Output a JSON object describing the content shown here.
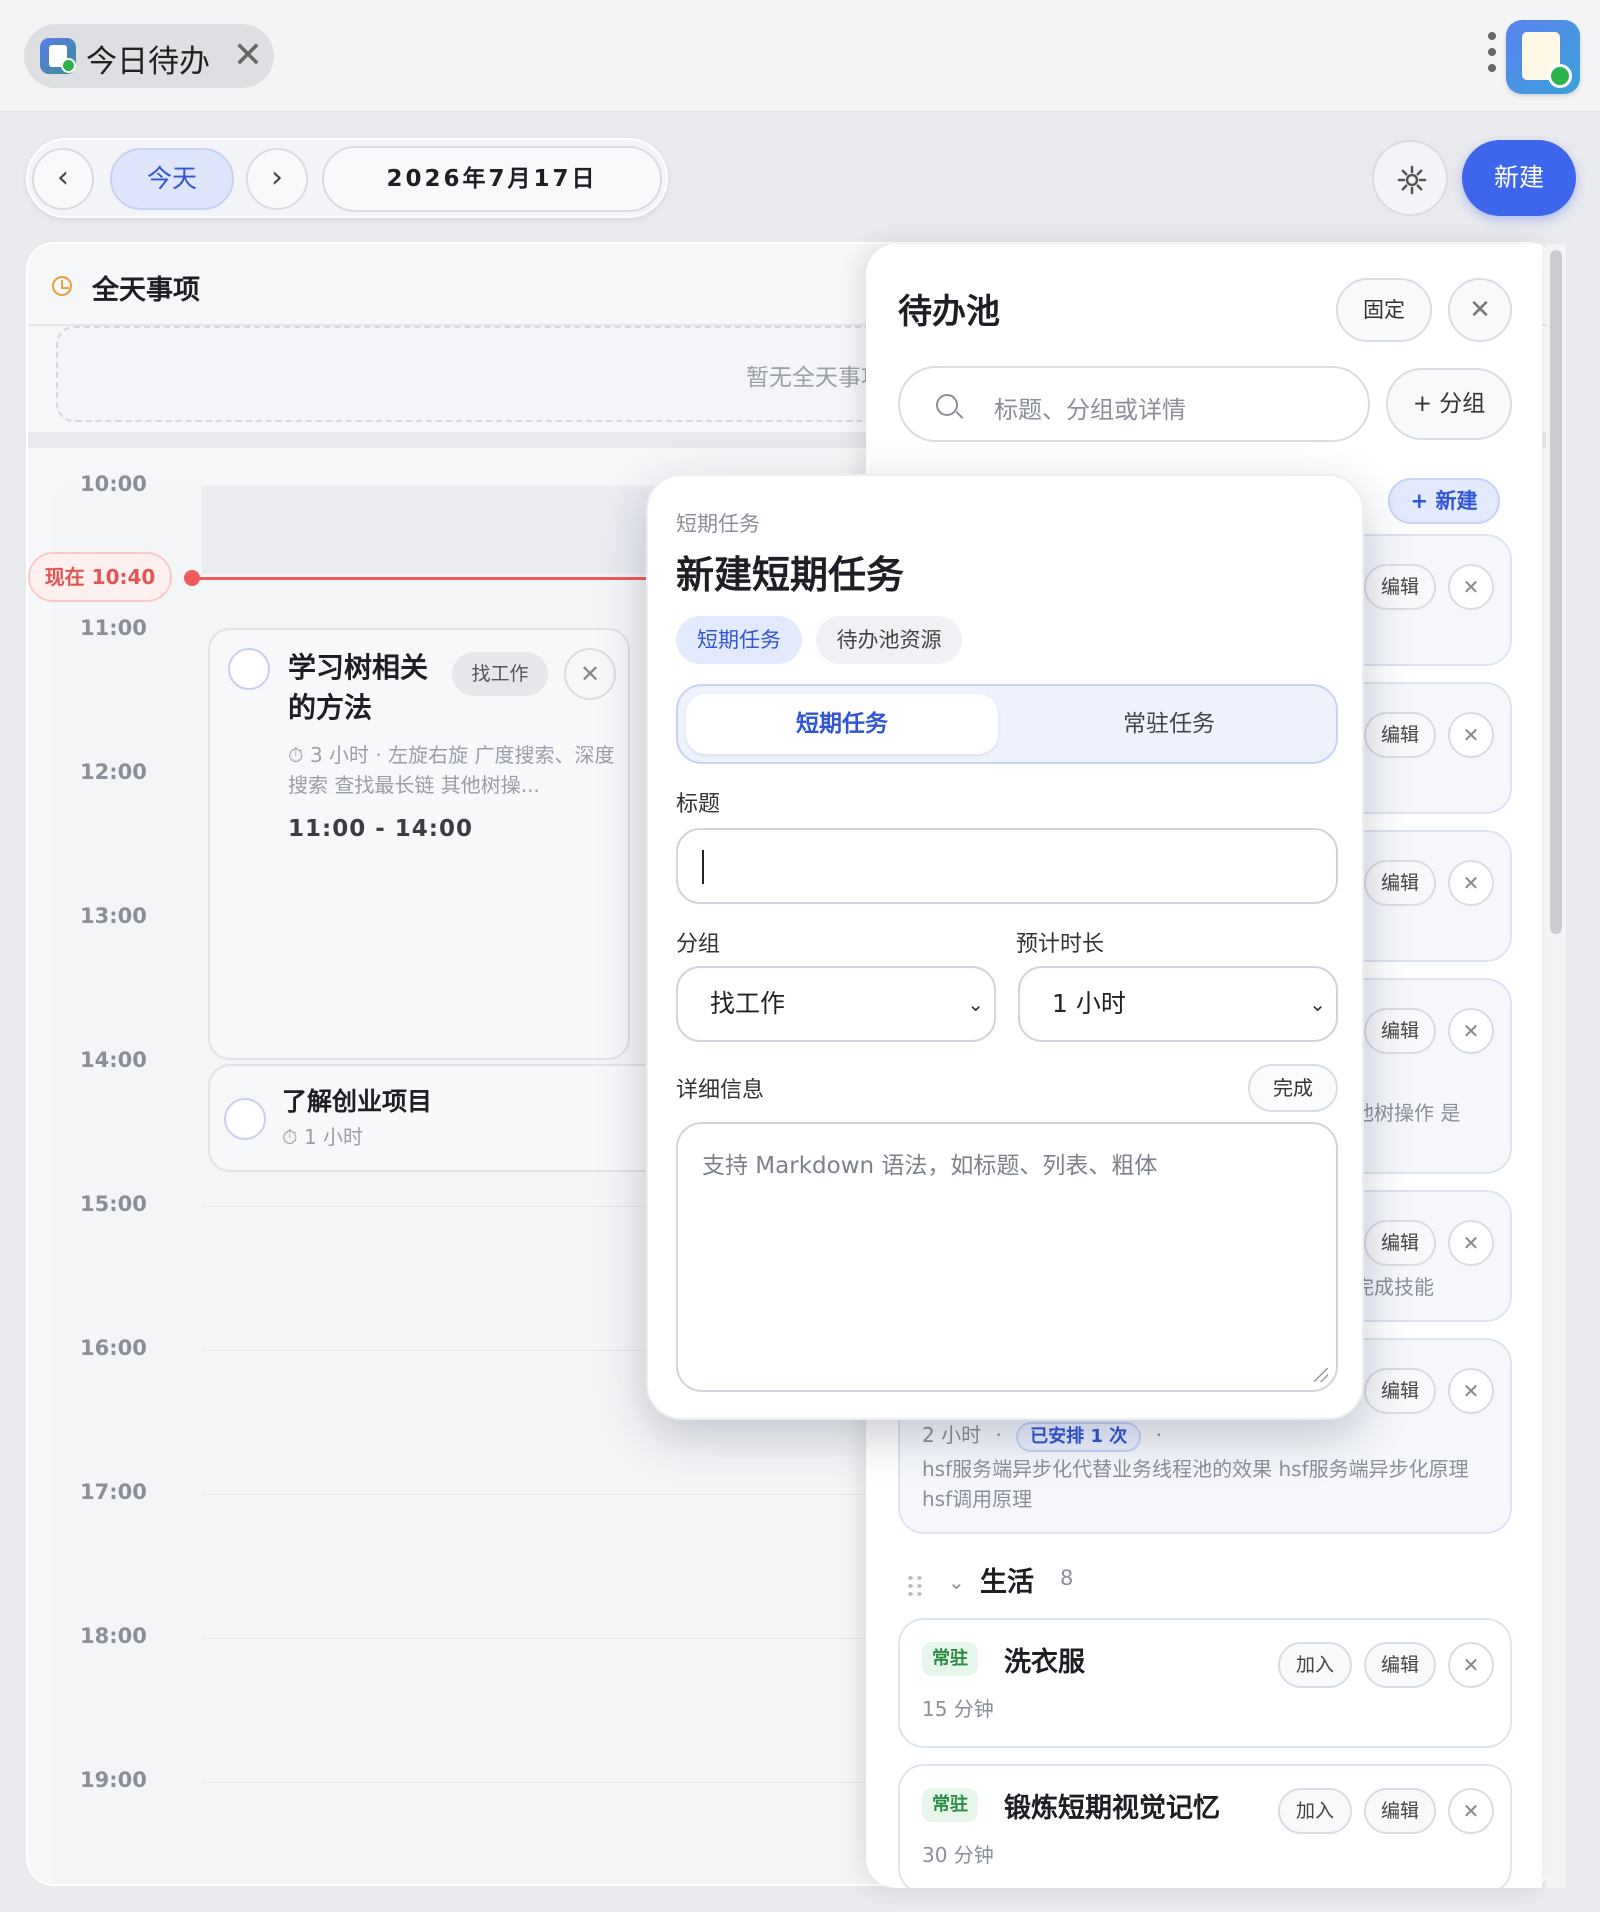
{
  "window": {
    "tab_title": "今日待办",
    "close_glyph": "✕"
  },
  "toolbar": {
    "prev_glyph": "‹",
    "next_glyph": "›",
    "today_label": "今天",
    "date_label": "2026年7月17日",
    "new_label": "新建"
  },
  "allday": {
    "title": "全天事项",
    "empty_text": "暂无全天事项"
  },
  "timeline": {
    "hours": [
      "10:00",
      "11:00",
      "12:00",
      "13:00",
      "14:00",
      "15:00",
      "16:00",
      "17:00",
      "18:00",
      "19:00"
    ],
    "now_label": "现在 10:40"
  },
  "events": [
    {
      "title": "学习树相关的方法",
      "group": "找工作",
      "meta": "⏱ 3 小时 · 左旋右旋 广度搜索、深度搜索 查找最长链 其他树操...",
      "time": "11:00 - 14:00"
    },
    {
      "title": "了解创业项目",
      "meta": "⏱ 1 小时"
    }
  ],
  "pool": {
    "title": "待办池",
    "pin_label": "固定",
    "close_glyph": "✕",
    "search_placeholder": "标题、分组或详情",
    "add_group_label": "+ 分组",
    "new_label": "+ 新建",
    "edit_label": "编辑",
    "join_label": "加入",
    "cards_partial": [
      {
        "visible_text": ""
      },
      {
        "visible_text": ""
      },
      {
        "visible_text": ""
      },
      {
        "visible_text": "他树操作 是"
      },
      {
        "visible_text": "完成技能"
      }
    ],
    "hsf_card": {
      "duration": "2 小时",
      "sep": "·",
      "scheduled": "已安排 1 次",
      "detail": "hsf服务端异步化代替业务线程池的效果 hsf服务端异步化原理 hsf调用原理"
    },
    "group_life": {
      "name": "生活",
      "count": "8"
    },
    "resident_cards": [
      {
        "tag": "常驻",
        "title": "洗衣服",
        "duration": "15 分钟"
      },
      {
        "tag": "常驻",
        "title": "锻炼短期视觉记忆",
        "duration": "30 分钟"
      }
    ]
  },
  "modal": {
    "kicker": "短期任务",
    "title": "新建短期任务",
    "tabs": [
      "短期任务",
      "待办池资源"
    ],
    "segment": [
      "短期任务",
      "常驻任务"
    ],
    "title_label": "标题",
    "title_value": "",
    "group_label": "分组",
    "group_value": "找工作",
    "duration_label": "预计时长",
    "duration_value": "1 小时",
    "detail_label": "详细信息",
    "done_label": "完成",
    "detail_placeholder": "支持 Markdown 语法，如标题、列表、粗体"
  },
  "colors": {
    "accent": "#3e66ec",
    "now_red": "#ef5a5a",
    "resident_green": "#2a8c45"
  },
  "icons": [
    "app-icon",
    "close-icon",
    "kebab-menu-icon",
    "gear-icon",
    "clock-icon",
    "search-icon",
    "drag-handle-icon",
    "chevron-down-icon",
    "resize-grip-icon"
  ]
}
